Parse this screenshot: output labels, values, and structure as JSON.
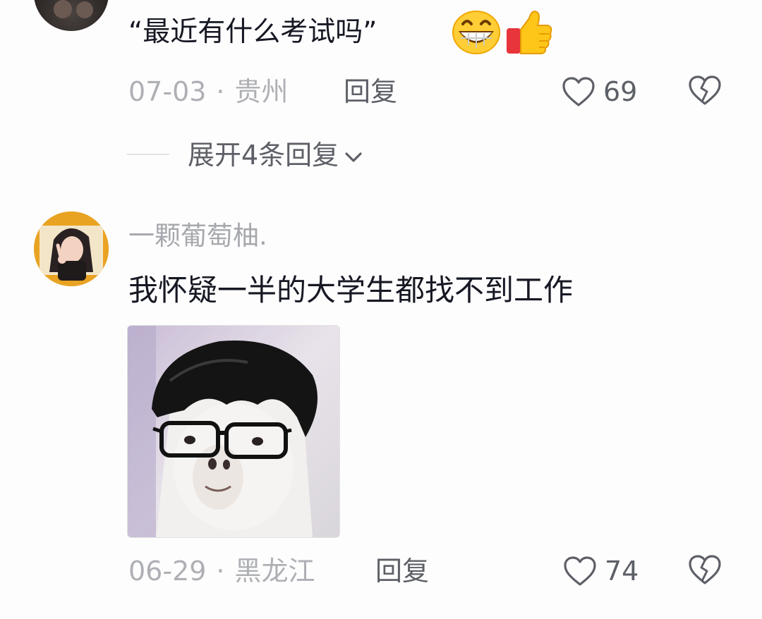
{
  "comments": [
    {
      "text": "“最近有什么考试吗”",
      "emojis": [
        "grin-emoji",
        "thumbs-up-emoji"
      ],
      "date": "07-03",
      "separator": "·",
      "location": "贵州",
      "reply_label": "回复",
      "likes": "69",
      "expand_label": "展开4条回复"
    },
    {
      "username": "一颗葡萄柚.",
      "text": "我怀疑一半的大学生都找不到工作",
      "sticker": "alpaca-with-wig-and-glasses",
      "date": "06-29",
      "separator": "·",
      "location": "黑龙江",
      "reply_label": "回复",
      "likes": "74"
    }
  ],
  "icons": {
    "like": "heart-outline-icon",
    "dislike": "broken-heart-icon",
    "expand": "chevron-down-icon"
  },
  "colors": {
    "meta_gray": "#aeb0b5",
    "action_gray": "#5e6068",
    "text_dark": "#161823"
  }
}
